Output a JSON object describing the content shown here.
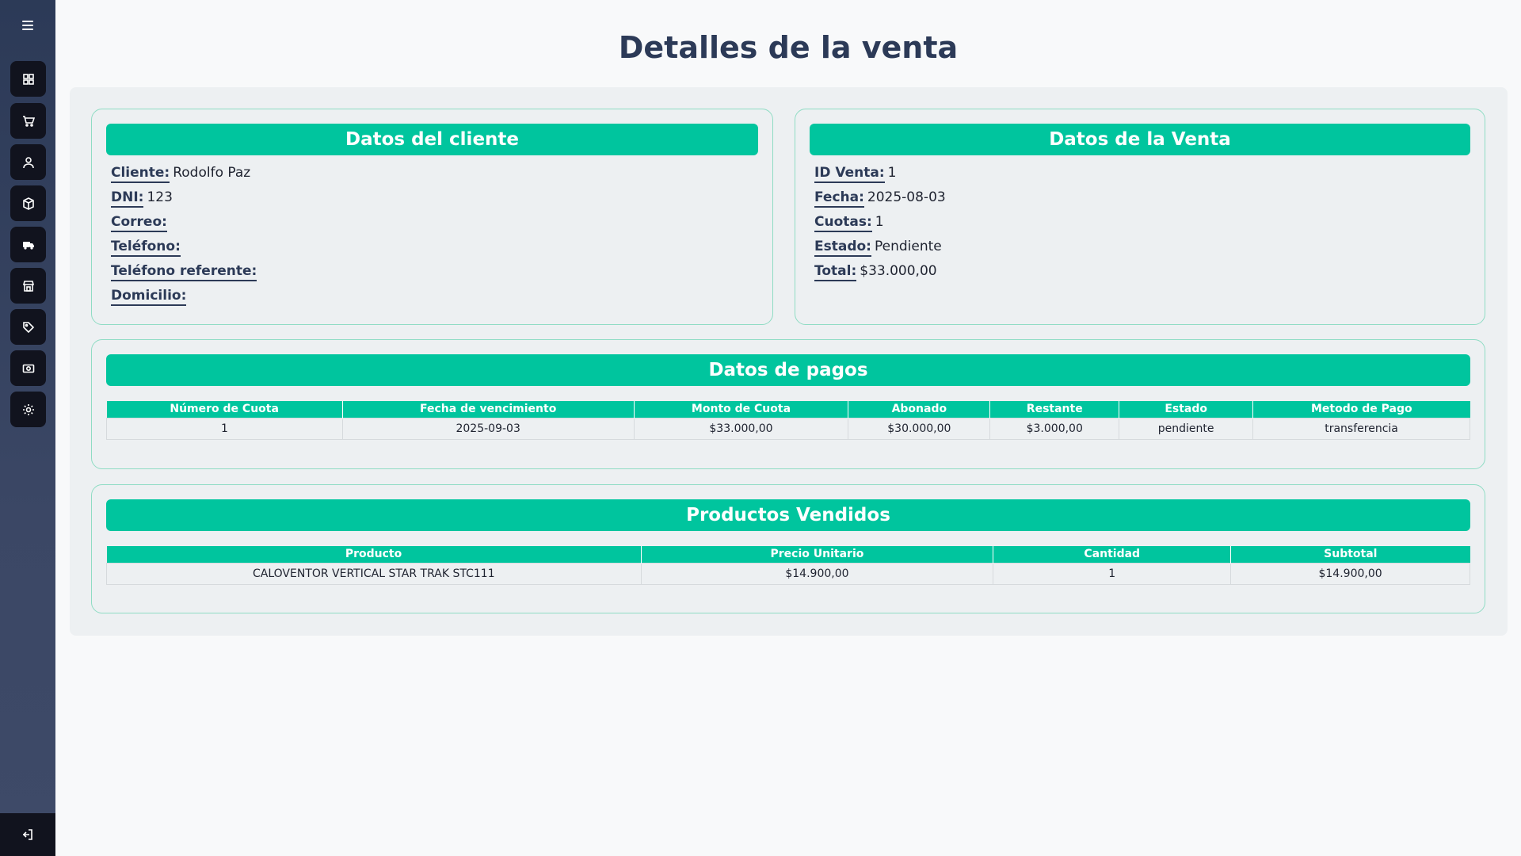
{
  "page": {
    "title": "Detalles de la venta"
  },
  "sidebar": {
    "items": [
      {
        "name": "dashboard",
        "icon": "grid-icon"
      },
      {
        "name": "ventas",
        "icon": "cart-icon"
      },
      {
        "name": "clientes",
        "icon": "user-icon"
      },
      {
        "name": "productos",
        "icon": "box-icon"
      },
      {
        "name": "envios",
        "icon": "truck-icon"
      },
      {
        "name": "tienda",
        "icon": "store-icon"
      },
      {
        "name": "etiquetas",
        "icon": "tag-icon"
      },
      {
        "name": "pagos",
        "icon": "cash-icon"
      },
      {
        "name": "configuracion",
        "icon": "gear-icon"
      }
    ],
    "logout_icon": "logout-icon"
  },
  "cliente": {
    "header": "Datos del cliente",
    "fields": [
      {
        "label": "Cliente:",
        "value": "Rodolfo Paz"
      },
      {
        "label": "DNI:",
        "value": "123"
      },
      {
        "label": "Correo:",
        "value": ""
      },
      {
        "label": "Teléfono:",
        "value": ""
      },
      {
        "label": "Teléfono referente:",
        "value": ""
      },
      {
        "label": "Domicilio:",
        "value": ""
      }
    ]
  },
  "venta": {
    "header": "Datos de la Venta",
    "fields": [
      {
        "label": "ID Venta:",
        "value": "1"
      },
      {
        "label": "Fecha:",
        "value": "2025-08-03"
      },
      {
        "label": "Cuotas:",
        "value": "1"
      },
      {
        "label": "Estado:",
        "value": "Pendiente"
      },
      {
        "label": "Total:",
        "value": "$33.000,00"
      }
    ]
  },
  "pagos": {
    "header": "Datos de pagos",
    "columns": [
      "Número de Cuota",
      "Fecha de vencimiento",
      "Monto de Cuota",
      "Abonado",
      "Restante",
      "Estado",
      "Metodo de Pago"
    ],
    "rows": [
      [
        "1",
        "2025-09-03",
        "$33.000,00",
        "$30.000,00",
        "$3.000,00",
        "pendiente",
        "transferencia"
      ]
    ]
  },
  "productos": {
    "header": "Productos Vendidos",
    "columns": [
      "Producto",
      "Precio Unitario",
      "Cantidad",
      "Subtotal"
    ],
    "rows": [
      [
        "CALOVENTOR VERTICAL STAR TRAK STC111",
        "$14.900,00",
        "1",
        "$14.900,00"
      ]
    ]
  },
  "colors": {
    "accent": "#00c59e",
    "sidebar": "#2c3a57",
    "title": "#2c3a57"
  }
}
